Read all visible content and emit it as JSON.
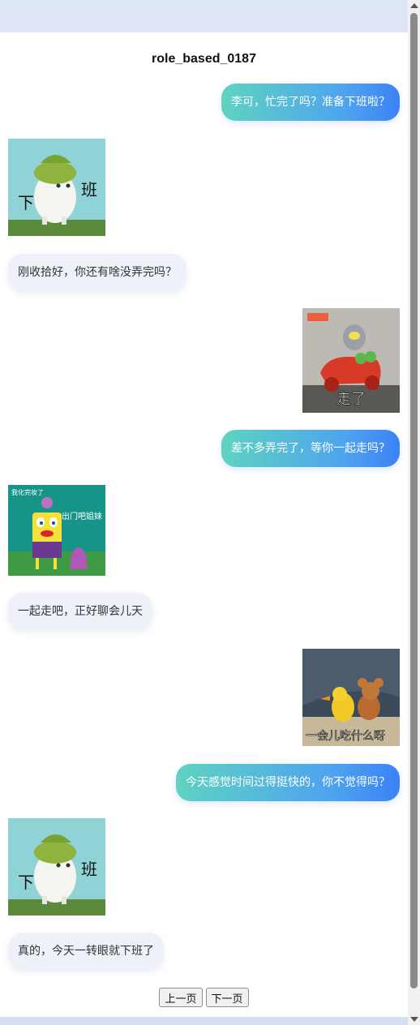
{
  "title": "role_based_0187",
  "messages": [
    {
      "side": "sent",
      "text": "李可，忙完了吗？准备下班啦？"
    },
    {
      "side": "recv",
      "sticker": "radish-off-work",
      "caption": [
        "下",
        "班"
      ]
    },
    {
      "side": "recv",
      "text": "刚收拾好，你还有啥没弄完吗？"
    },
    {
      "side": "sent",
      "sticker": "ultraman-car-leaving",
      "caption": [
        "走了"
      ]
    },
    {
      "side": "sent",
      "text": "差不多弄完了，等你一起走吗？"
    },
    {
      "side": "recv",
      "sticker": "spongebob-makeup",
      "caption": [
        "我化完妆了",
        "出门吧姐妹"
      ]
    },
    {
      "side": "recv",
      "text": "一起走吧，正好聊会儿天"
    },
    {
      "side": "sent",
      "sticker": "jerry-and-bird",
      "caption": [
        "一会儿吃什么呀"
      ]
    },
    {
      "side": "sent",
      "text": "今天感觉时间过得挺快的，你不觉得吗？"
    },
    {
      "side": "recv",
      "sticker": "radish-off-work",
      "caption": [
        "下",
        "班"
      ]
    },
    {
      "side": "recv",
      "text": "真的，今天一转眼就下班了"
    }
  ],
  "pager": {
    "prev": "上一页",
    "next": "下一页"
  },
  "colors": {
    "sent_start": "#5fd3c1",
    "sent_end": "#3b82f6",
    "recv_bg": "#eef2f8"
  }
}
